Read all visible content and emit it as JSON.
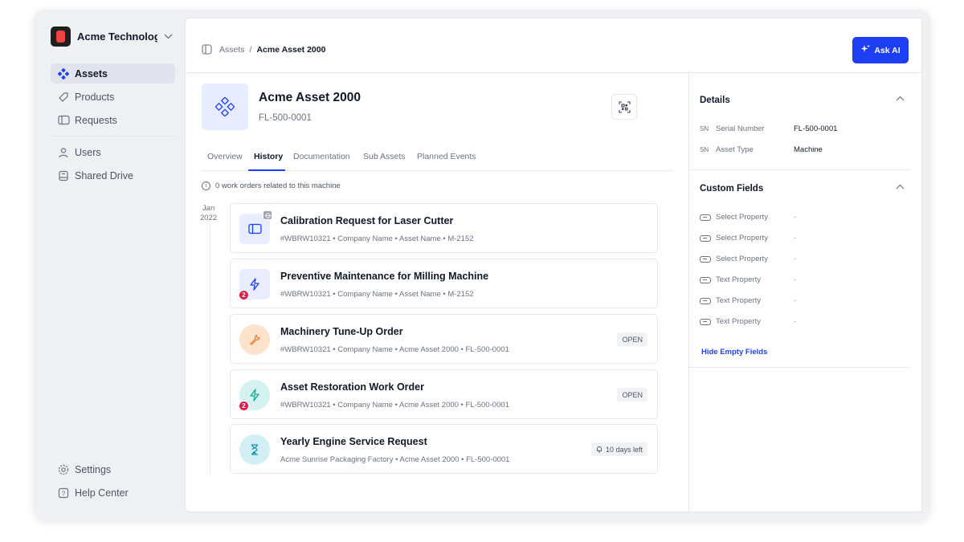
{
  "org": {
    "name": "Acme Technologi..."
  },
  "sidebar": {
    "items": [
      {
        "label": "Assets",
        "icon": "diamond-grid-icon"
      },
      {
        "label": "Products",
        "icon": "tag-icon"
      },
      {
        "label": "Requests",
        "icon": "inbox-icon"
      },
      {
        "label": "Users",
        "icon": "user-icon"
      },
      {
        "label": "Shared Drive",
        "icon": "drive-icon"
      }
    ],
    "footer": [
      {
        "label": "Settings",
        "icon": "gear-icon"
      },
      {
        "label": "Help Center",
        "icon": "help-icon"
      }
    ]
  },
  "breadcrumb": {
    "root": "Assets",
    "separator": "/",
    "current": "Acme Asset 2000"
  },
  "ask_ai": {
    "label": "Ask AI"
  },
  "asset": {
    "name": "Acme Asset 2000",
    "code": "FL-500-0001"
  },
  "tabs": [
    "Overview",
    "History",
    "Documentation",
    "Sub Assets",
    "Planned Events"
  ],
  "info_text": "0 work orders related to this machine",
  "timeline": {
    "month": "Jan",
    "year": "2022"
  },
  "work_orders": [
    {
      "title": "Calibration Request for Laser Cutter",
      "meta": "#WBRW10321  •  Company Name  •  Asset Name  •  M-2152",
      "icon": "inbox-icon",
      "status": ""
    },
    {
      "title": "Preventive Maintenance for Milling Machine",
      "meta": "#WBRW10321  •  Company Name  •  Asset Name  •  M-2152",
      "icon": "lightning-icon",
      "badge": "2",
      "status": ""
    },
    {
      "title": "Machinery Tune-Up Order",
      "meta": "#WBRW10321  •  Company Name  •  Acme Asset 2000  •  FL-500-0001",
      "icon": "wrench-icon",
      "status": "OPEN"
    },
    {
      "title": "Asset Restoration Work Order",
      "meta": "#WBRW10321  •  Company Name  •  Acme Asset 2000  •  FL-500-0001",
      "icon": "lightning-icon",
      "badge": "2",
      "status": "OPEN"
    },
    {
      "title": "Yearly Engine Service Request",
      "meta": "Acme Sunrise Packaging Factory  •  Acme Asset 2000  •  FL-500-0001",
      "icon": "hourglass-icon",
      "status": "10 days left"
    }
  ],
  "details": {
    "title": "Details",
    "rows": [
      {
        "tag": "SN",
        "label": "Serial Number",
        "value": "FL-500-0001"
      },
      {
        "tag": "SN",
        "label": "Asset Type",
        "value": "Machine"
      }
    ]
  },
  "custom_fields": {
    "title": "Custom Fields",
    "rows": [
      {
        "label": "Select Property",
        "value": "-"
      },
      {
        "label": "Select Property",
        "value": "-"
      },
      {
        "label": "Select Property",
        "value": "-"
      },
      {
        "label": "Text Property",
        "value": "-"
      },
      {
        "label": "Text Property",
        "value": "-"
      },
      {
        "label": "Text Property",
        "value": "-"
      }
    ],
    "hide_label": "Hide Empty Fields"
  },
  "colors": {
    "accent": "#1d3ef2",
    "badge": "#e11d48",
    "sidebar_bg": "#eef0f4"
  }
}
